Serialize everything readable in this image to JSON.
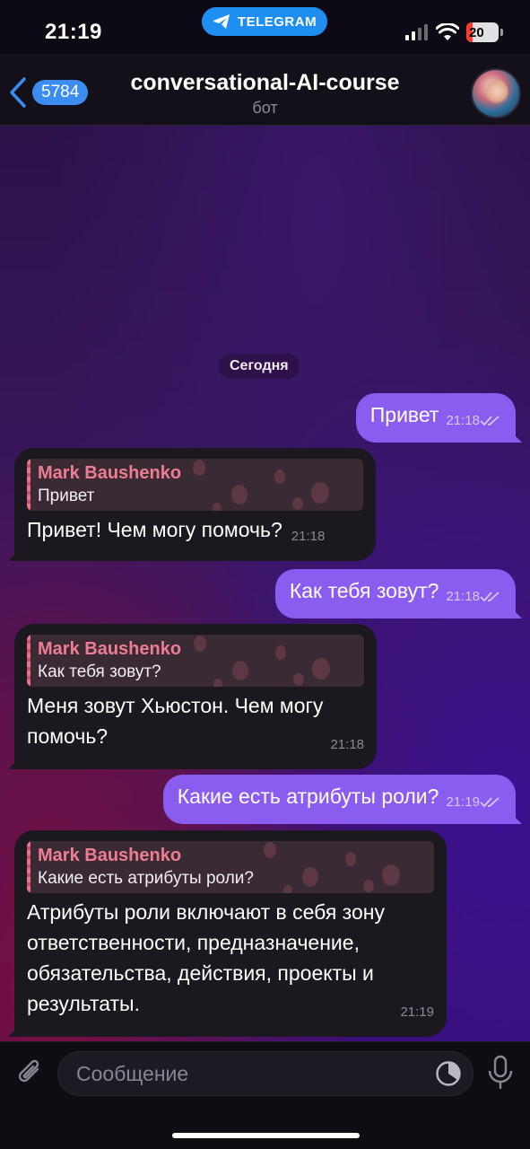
{
  "status_bar": {
    "time": "21:19",
    "app_pill": "TELEGRAM",
    "battery": "20"
  },
  "header": {
    "back_count": "5784",
    "title": "conversational-AI-course",
    "subtitle": "бот"
  },
  "date_label": "Сегодня",
  "messages": [
    {
      "type": "out",
      "text": "Привет",
      "time": "21:18"
    },
    {
      "type": "in",
      "reply_name": "Mark Baushenko",
      "reply_text": "Привет",
      "text": "Привет! Чем могу помочь?",
      "time": "21:18"
    },
    {
      "type": "out",
      "text": "Как тебя зовут?",
      "time": "21:18"
    },
    {
      "type": "in",
      "reply_name": "Mark Baushenko",
      "reply_text": "Как тебя зовут?",
      "text": "Меня зовут Хьюстон. Чем могу помочь?",
      "time": "21:18"
    },
    {
      "type": "out",
      "text": "Какие есть атрибуты роли?",
      "time": "21:19"
    },
    {
      "type": "in",
      "reply_name": "Mark Baushenko",
      "reply_text": "Какие есть атрибуты роли?",
      "text": "Атрибуты роли включают в себя зону ответственности, предназначение, обязательства, действия, проекты и результаты.",
      "time": "21:19"
    }
  ],
  "input": {
    "placeholder": "Сообщение"
  },
  "colors": {
    "outgoing_bubble": "#8a5cf0",
    "incoming_bubble": "#1b1820",
    "reply_name": "#ef7d92",
    "accent": "#3b8df1"
  }
}
